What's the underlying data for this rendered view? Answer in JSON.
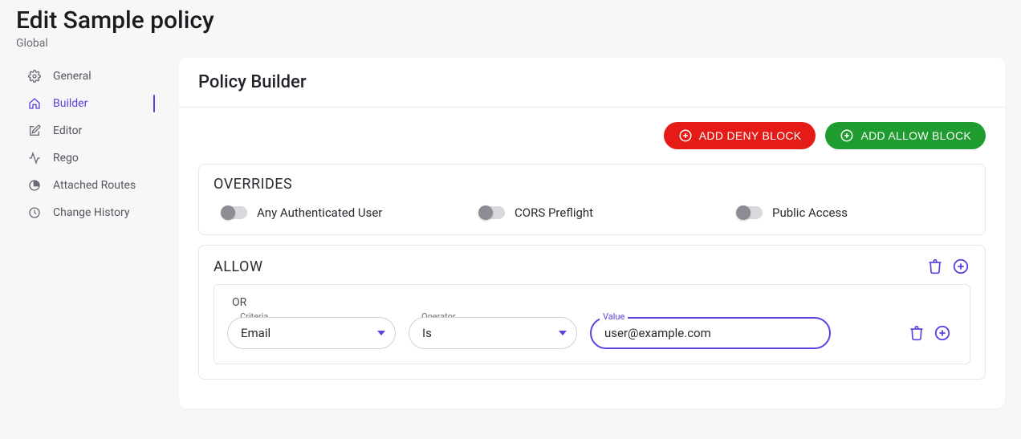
{
  "header": {
    "title": "Edit Sample policy",
    "subtitle": "Global"
  },
  "sidebar": {
    "items": [
      {
        "label": "General"
      },
      {
        "label": "Builder"
      },
      {
        "label": "Editor"
      },
      {
        "label": "Rego"
      },
      {
        "label": "Attached Routes"
      },
      {
        "label": "Change History"
      }
    ],
    "active_index": 1
  },
  "main": {
    "title": "Policy Builder",
    "actions": {
      "add_deny_label": "ADD DENY BLOCK",
      "add_allow_label": "ADD ALLOW BLOCK"
    },
    "overrides": {
      "title": "OVERRIDES",
      "items": [
        {
          "label": "Any Authenticated User",
          "on": false
        },
        {
          "label": "CORS Preflight",
          "on": false
        },
        {
          "label": "Public Access",
          "on": false
        }
      ]
    },
    "allow_block": {
      "title": "ALLOW",
      "groups": [
        {
          "joiner": "OR",
          "rules": [
            {
              "criteria_label": "Criteria",
              "criteria_value": "Email",
              "operator_label": "Operator",
              "operator_value": "Is",
              "value_label": "Value",
              "value_value": "user@example.com"
            }
          ]
        }
      ]
    }
  },
  "colors": {
    "accent": "#5d41de",
    "deny": "#e41b17",
    "allow": "#1f9c30"
  }
}
